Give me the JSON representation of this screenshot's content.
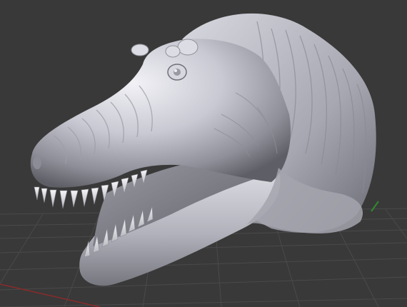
{
  "viewport": {
    "background": "#393939",
    "grid_color": "#4a4a4a",
    "x_axis_color": "#8b2a2a",
    "y_axis_color": "#2f8a2f",
    "model_color": "#c6c6cf",
    "model": "t-rex-head-sculpt",
    "shading": "solid"
  }
}
